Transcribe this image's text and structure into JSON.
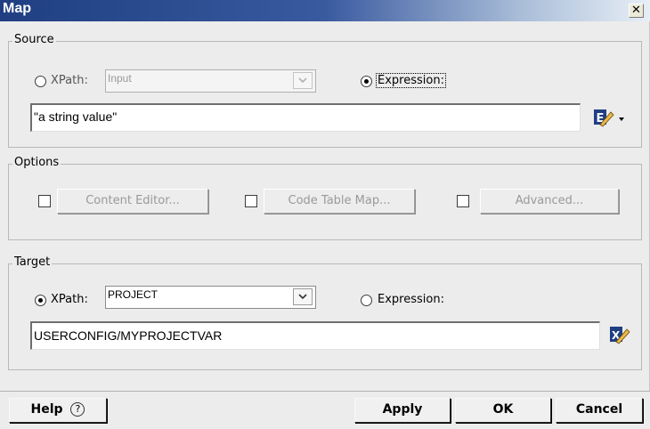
{
  "window": {
    "title": "Map"
  },
  "source": {
    "legend": "Source",
    "xpath_label": "XPath:",
    "xpath_value": "Input",
    "expression_label": "Expression:",
    "mode": "expression",
    "value": "\"a string value\""
  },
  "options": {
    "legend": "Options",
    "buttons": {
      "content_editor": "Content Editor...",
      "code_table_map": "Code Table Map...",
      "advanced": "Advanced..."
    }
  },
  "target": {
    "legend": "Target",
    "xpath_label": "XPath:",
    "xpath_value": "PROJECT",
    "expression_label": "Expression:",
    "mode": "xpath",
    "value": "USERCONFIG/MYPROJECTVAR"
  },
  "footer": {
    "help_label": "Help",
    "help_glyph": "?",
    "apply_label": "Apply",
    "ok_label": "OK",
    "cancel_label": "Cancel"
  },
  "icons": {
    "close": "close-icon",
    "dropdown": "chevron-down-icon",
    "expression_editor": "expression-editor-icon",
    "xpath_editor": "xpath-editor-icon",
    "help": "help-circle-icon"
  }
}
